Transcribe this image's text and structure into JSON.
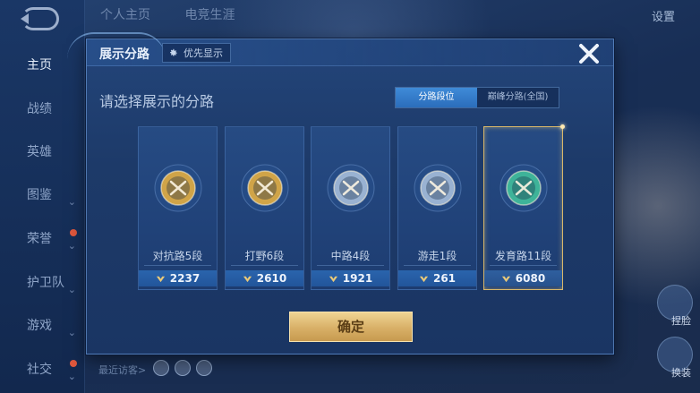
{
  "background": {
    "top_tabs": [
      "个人主页",
      "电竞生涯"
    ],
    "top_right_label": "设置",
    "sidebar_items": [
      {
        "label": "主页",
        "active": true,
        "arrow": false,
        "reddot": false
      },
      {
        "label": "战绩",
        "active": false,
        "arrow": false,
        "reddot": false
      },
      {
        "label": "英雄",
        "active": false,
        "arrow": false,
        "reddot": false
      },
      {
        "label": "图鉴",
        "active": false,
        "arrow": true,
        "reddot": false
      },
      {
        "label": "荣誉",
        "active": false,
        "arrow": true,
        "reddot": true
      },
      {
        "label": "护卫队",
        "active": false,
        "arrow": true,
        "reddot": false
      },
      {
        "label": "游戏",
        "active": false,
        "arrow": true,
        "reddot": false
      },
      {
        "label": "社交",
        "active": false,
        "arrow": true,
        "reddot": true
      }
    ],
    "recent_visitors_label": "最近访客>",
    "corner_buttons": [
      "捏脸",
      "换装"
    ]
  },
  "modal": {
    "title": "展示分路",
    "priority_label": "优先显示",
    "subtitle": "请选择展示的分路",
    "toggle": {
      "options": [
        "分路段位",
        "巅峰分路(全国)"
      ],
      "active_index": 0
    },
    "cards": [
      {
        "name": "对抗路5段",
        "score": "2237",
        "emblem": "clash-lane-emblem-icon",
        "selected": false,
        "tint": "#d9a945"
      },
      {
        "name": "打野6段",
        "score": "2610",
        "emblem": "jungle-emblem-icon",
        "selected": false,
        "tint": "#d9a945"
      },
      {
        "name": "中路4段",
        "score": "1921",
        "emblem": "mid-lane-emblem-icon",
        "selected": false,
        "tint": "#9fb7d6"
      },
      {
        "name": "游走1段",
        "score": "261",
        "emblem": "roam-emblem-icon",
        "selected": false,
        "tint": "#9fb7d6"
      },
      {
        "name": "发育路11段",
        "score": "6080",
        "emblem": "farm-lane-emblem-icon",
        "selected": true,
        "tint": "#3fb89a"
      }
    ],
    "confirm_label": "确定"
  },
  "colors": {
    "accent_blue": "#3f8bd8",
    "gold": "#d9b86a",
    "panel": "#1d3a69"
  }
}
